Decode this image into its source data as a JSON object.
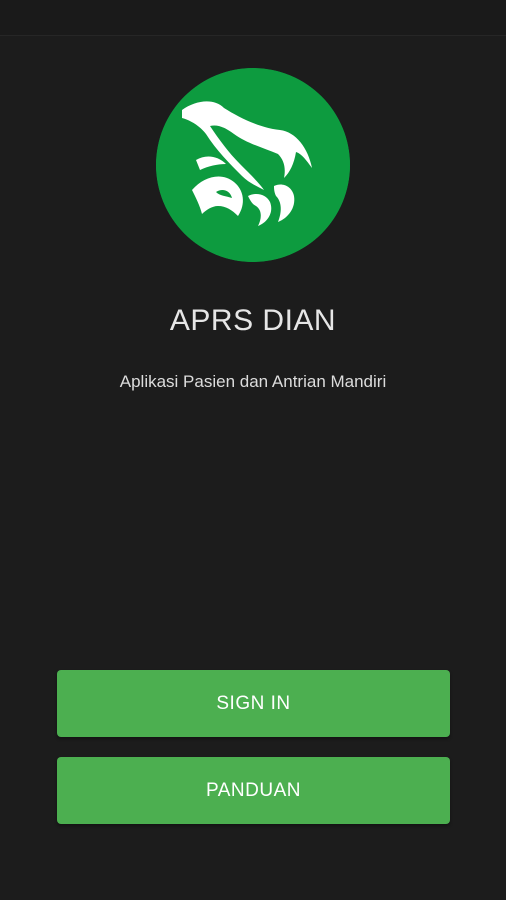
{
  "app": {
    "title": "APRS DIAN",
    "subtitle": "Aplikasi Pasien dan Antrian Mandiri",
    "logo_icon": "hospital-logo-icon"
  },
  "actions": {
    "sign_in_label": "SIGN IN",
    "guide_label": "PANDUAN"
  },
  "colors": {
    "background": "#1c1c1c",
    "logo_green": "#0d9b3f",
    "button_green": "#4caf50",
    "text": "#e6e6e6"
  }
}
